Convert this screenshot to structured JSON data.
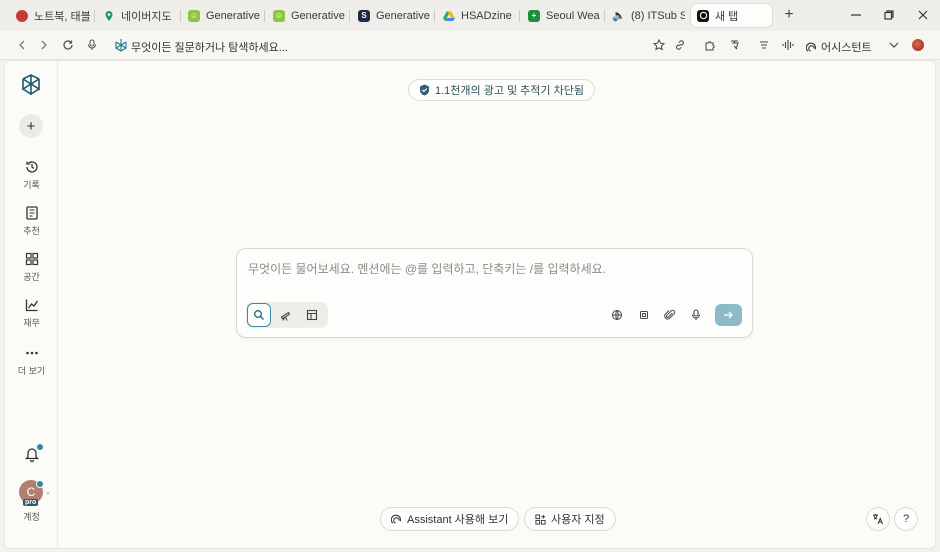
{
  "tabs": [
    {
      "label": "노트북, 태블",
      "icon": "red-circle-favicon",
      "color": "#c83a3a"
    },
    {
      "label": "네이버지도",
      "icon": "map-pin-favicon",
      "color": "#1e9e5a"
    },
    {
      "label": "Generative",
      "icon": "smiley-favicon",
      "color": "#8cc63f"
    },
    {
      "label": "Generative",
      "icon": "smiley-favicon",
      "color": "#8cc63f"
    },
    {
      "label": "Generative",
      "icon": "sn-favicon",
      "color": "#1d2a44"
    },
    {
      "label": "HSADzine",
      "icon": "drive-favicon",
      "color": "#4285f4"
    },
    {
      "label": "Seoul Wea",
      "icon": "sheets-favicon",
      "color": "#1e8e3e"
    },
    {
      "label": "(8) ITSub S",
      "icon": "audio-favicon",
      "color": "#c0392b"
    },
    {
      "label": "새 탭",
      "icon": "perplexity-favicon",
      "color": "#111111"
    }
  ],
  "addressbar": {
    "placeholder": "무엇이든 질문하거나 탐색하세요...",
    "assistant_label": "어시스턴트"
  },
  "sidebar": {
    "items": [
      {
        "label": "기록",
        "icon": "history-icon"
      },
      {
        "label": "추천",
        "icon": "discover-icon"
      },
      {
        "label": "공간",
        "icon": "spaces-icon"
      },
      {
        "label": "재무",
        "icon": "finance-icon"
      },
      {
        "label": "더 보기",
        "icon": "more-icon"
      }
    ],
    "avatar_initial": "C",
    "pro_badge": "pro",
    "account_label": "계정"
  },
  "main": {
    "blocked_text": "1.1천개의 광고 및 추적기 차단됨",
    "ask_placeholder": "무엇이든 물어보세요. 멘션에는 @를 입력하고, 단축키는 /를 입력하세요.",
    "assistant_button": "Assistant 사용해 보기",
    "customize_button": "사용자 지정",
    "help_label": "?"
  },
  "colors": {
    "accent": "#2a8aa0",
    "submit": "#8bbcc6"
  }
}
